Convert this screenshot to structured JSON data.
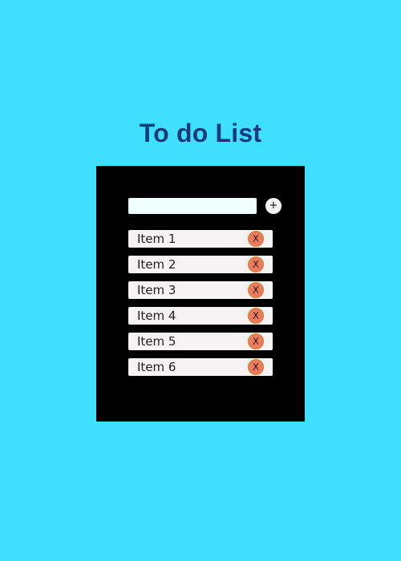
{
  "page": {
    "title": "To do List"
  },
  "input": {
    "value": "",
    "placeholder": ""
  },
  "add_button": {
    "label": "+"
  },
  "items": [
    {
      "label": "Item 1",
      "remove_label": "X"
    },
    {
      "label": "Item 2",
      "remove_label": "X"
    },
    {
      "label": "Item 3",
      "remove_label": "X"
    },
    {
      "label": "Item 4",
      "remove_label": "X"
    },
    {
      "label": "Item 5",
      "remove_label": "X"
    },
    {
      "label": "Item 6",
      "remove_label": "X"
    }
  ],
  "colors": {
    "background": "#3fe0ff",
    "title": "#173a7a",
    "panel": "#000000",
    "input": "#f0ffff",
    "item": "#f5f3f3",
    "remove_button": "#ef7b5c"
  }
}
